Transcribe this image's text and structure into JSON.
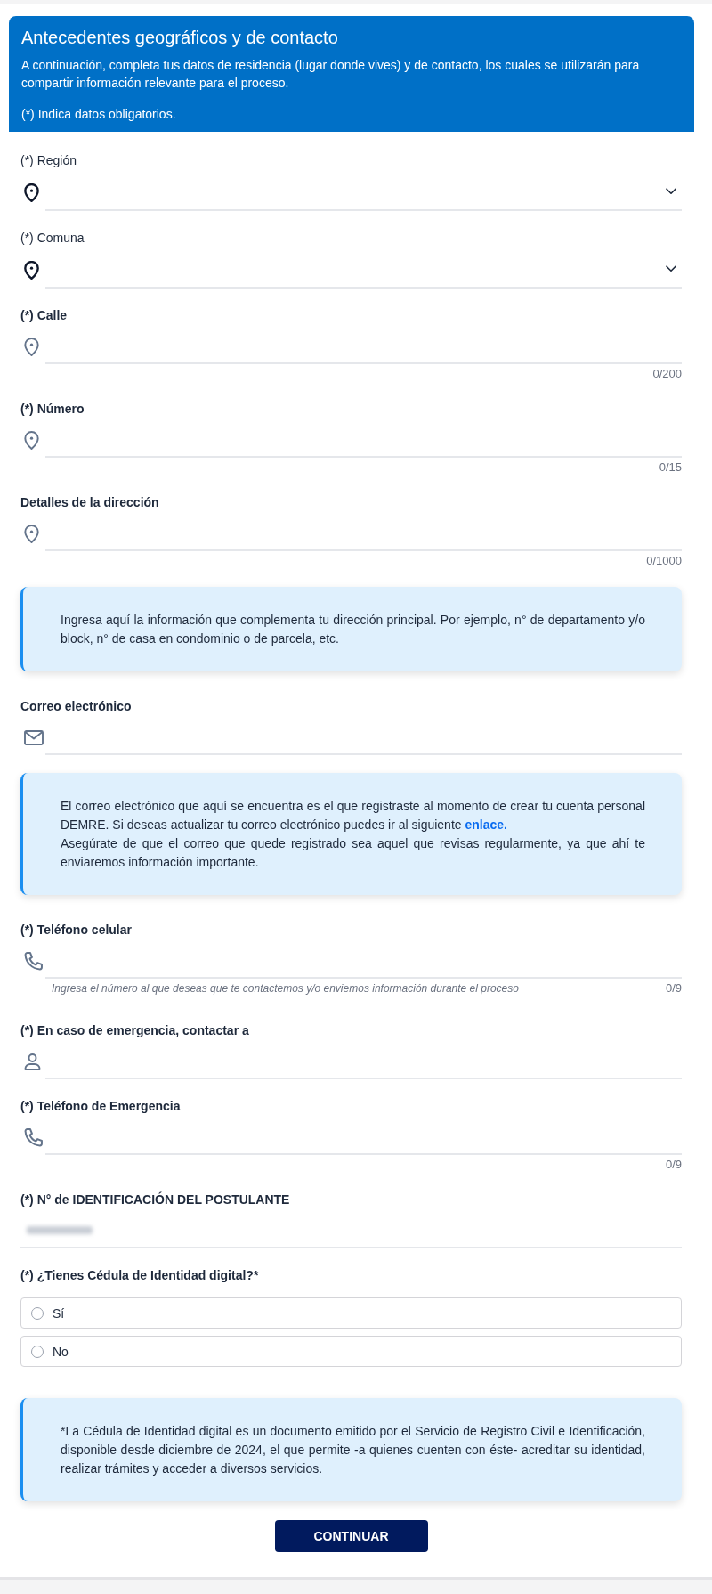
{
  "header": {
    "title": "Antecedentes geográficos y de contacto",
    "description": "A continuación, completa tus datos de residencia (lugar donde vives) y de contacto, los cuales se utilizarán para compartir información relevante para el proceso.",
    "note": "(*) Indica datos obligatorios."
  },
  "fields": [
    {
      "kind": "select",
      "label": "(*) Región"
    },
    {
      "kind": "select",
      "label": "(*) Comuna"
    },
    {
      "kind": "address",
      "label": "(*) Calle",
      "counter": "0/200"
    },
    {
      "kind": "address",
      "label": "(*) Número",
      "counter": "0/15"
    },
    {
      "kind": "address",
      "label": "Detalles de la dirección",
      "counter": "0/1000",
      "notice": {
        "paragraphs": [
          {
            "text": "Ingresa aquí la información que complementa tu dirección principal. Por ejemplo, n° de departamento y/o block, n° de casa en condominio o de parcela, etc."
          }
        ]
      }
    },
    {
      "kind": "email",
      "label": "Correo electrónico",
      "notice": {
        "paragraphs": [
          {
            "text": "El correo electrónico que aquí se encuentra es el que registraste al momento de crear tu cuenta personal DEMRE. Si deseas actualizar tu correo electrónico puedes ir al siguiente",
            "link": "enlace."
          },
          {
            "text": "Asegúrate de que el correo que quede registrado sea aquel que revisas regularmente, ya que ahí te enviaremos información importante."
          }
        ]
      }
    },
    {
      "kind": "phone",
      "label": "(*) Teléfono celular",
      "hint": "Ingresa el número al que deseas que te contactemos y/o enviemos información durante el proceso",
      "counter": "0/9"
    },
    {
      "kind": "contact",
      "label": "(*) En caso de emergencia, contactar a"
    },
    {
      "kind": "phone",
      "label": "(*) Teléfono de Emergencia",
      "counter": "0/9"
    },
    {
      "kind": "identification",
      "label": "(*) N° de IDENTIFICACIÓN DEL POSTULANTE",
      "value_blurred": true
    }
  ],
  "question": {
    "label": "(*) ¿Tienes Cédula de Identidad digital?*",
    "options": [
      {
        "label": "Sí",
        "selected": false
      },
      {
        "label": "No",
        "selected": false
      }
    ],
    "notice": {
      "paragraphs": [
        {
          "text": "*La Cédula de Identidad digital es un documento emitido por el Servicio de Registro Civil e Identificación, disponible desde diciembre de 2024, el que permite -a quienes cuenten con éste- acreditar su identidad, realizar trámites y acceder a diversos servicios."
        }
      ]
    }
  },
  "submit": {
    "label": "CONTINUAR"
  }
}
